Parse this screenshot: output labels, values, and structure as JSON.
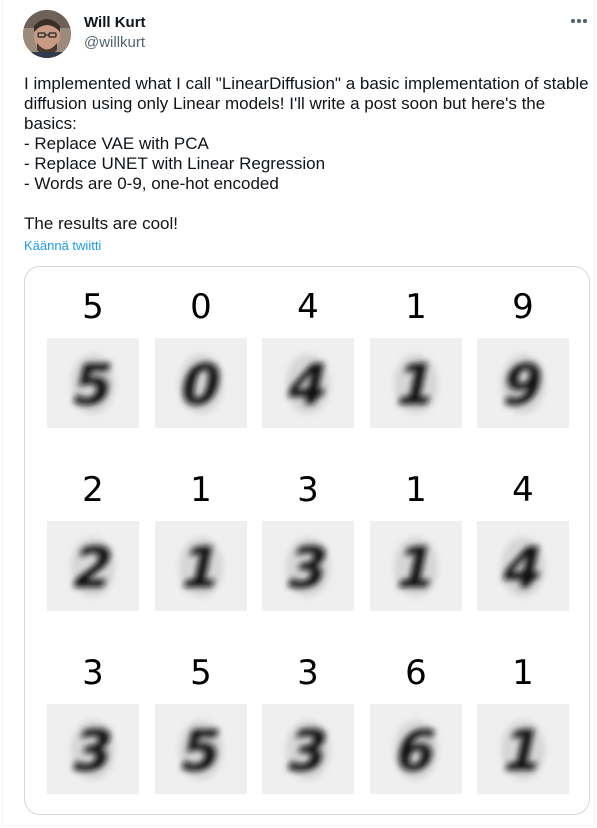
{
  "author": {
    "display_name": "Will Kurt",
    "handle": "@willkurt",
    "avatar_icon": "user-avatar-photo"
  },
  "menu": {
    "icon": "more-horizontal-icon"
  },
  "tweet_text": "I implemented what I call \"LinearDiffusion\" a basic implementation of stable diffusion using only Linear models! I'll write a post soon but here's the basics:\n- Replace VAE with PCA\n- Replace UNET with Linear Regression\n- Words are 0-9, one-hot encoded\n\nThe results are cool!",
  "translate_label": "Käännä twiitti",
  "image_grid": {
    "rows": [
      {
        "labels": [
          "5",
          "0",
          "4",
          "1",
          "9"
        ]
      },
      {
        "labels": [
          "2",
          "1",
          "3",
          "1",
          "4"
        ]
      },
      {
        "labels": [
          "3",
          "5",
          "3",
          "6",
          "1"
        ]
      }
    ]
  }
}
